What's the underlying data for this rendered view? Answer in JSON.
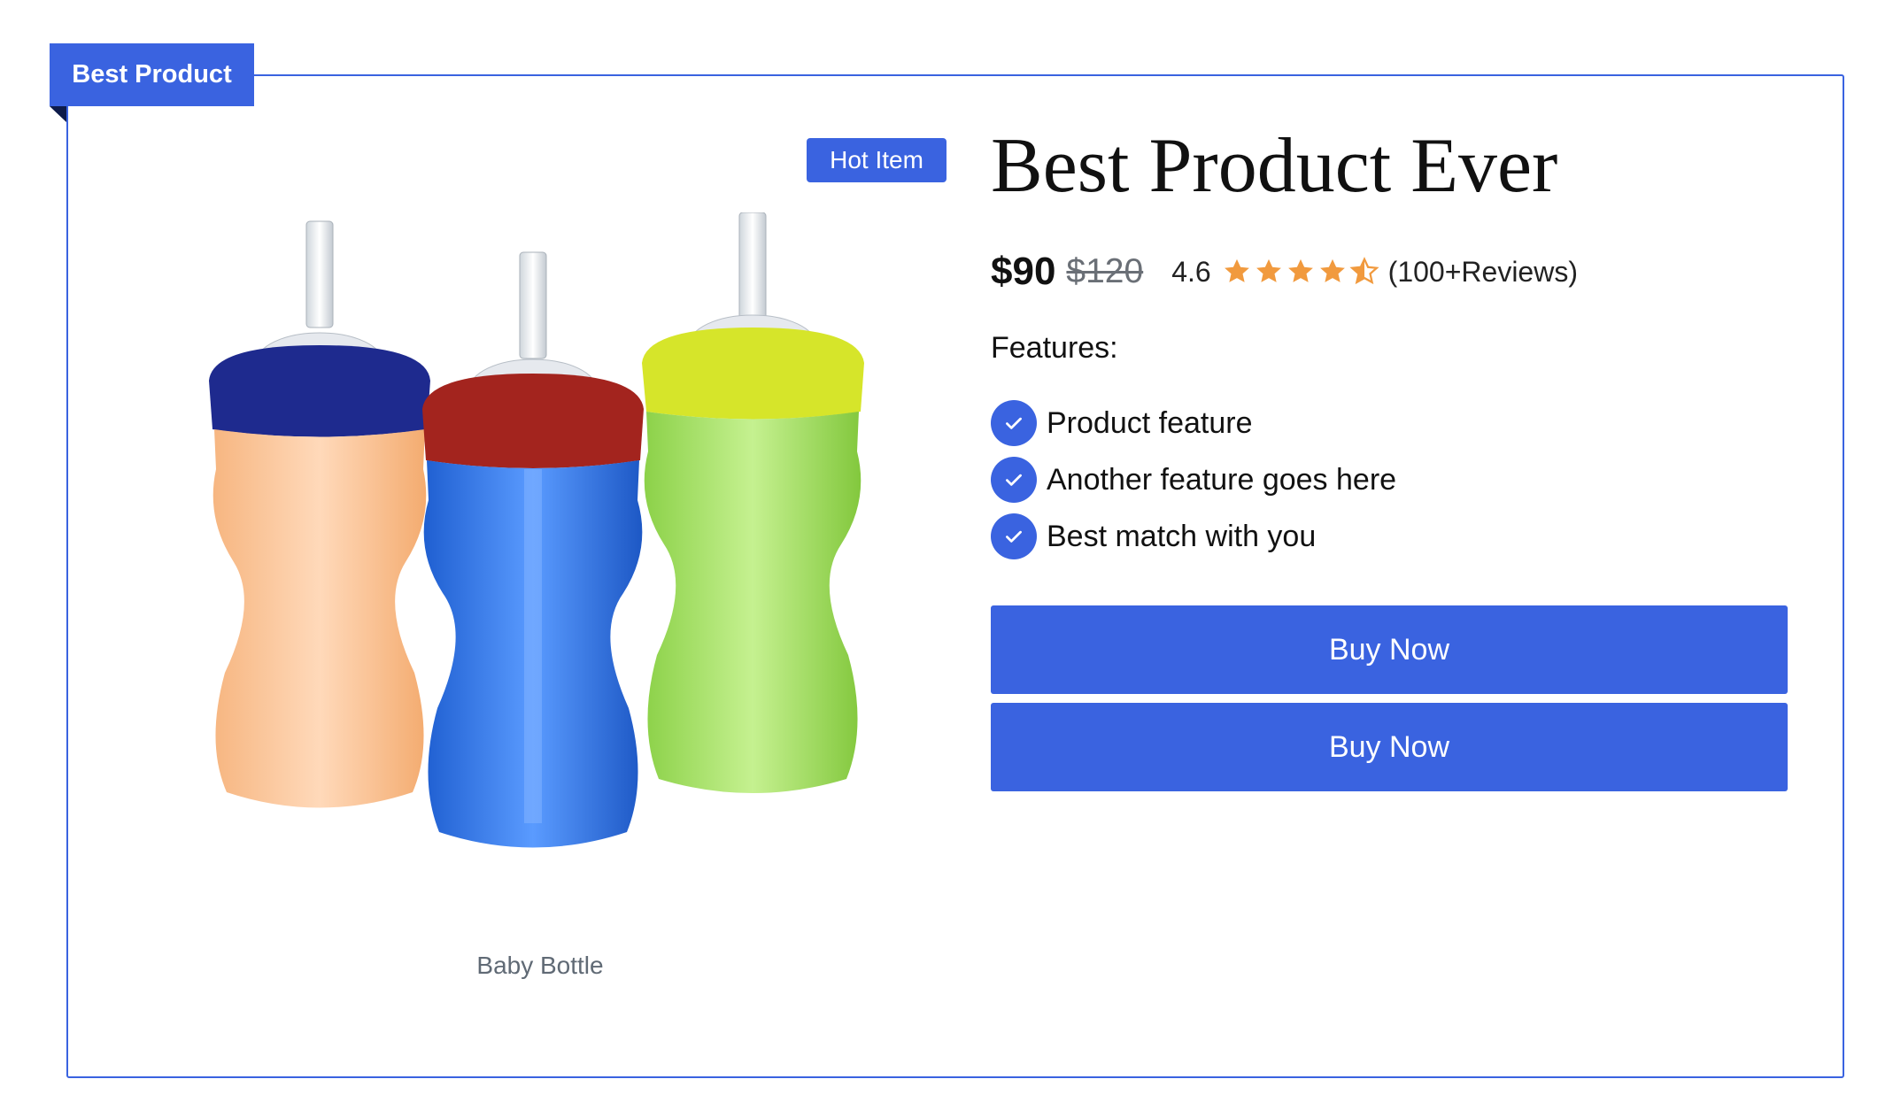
{
  "badge": {
    "label": "Best Product"
  },
  "hot_tag": {
    "label": "Hot Item"
  },
  "image": {
    "caption": "Baby Bottle",
    "alt": "Baby Bottle"
  },
  "product": {
    "title": "Best Product Ever",
    "price": "$90",
    "old_price": "$120",
    "rating": "4.6",
    "rating_value": 4.6,
    "rating_max": 5,
    "reviews": "(100+Reviews)"
  },
  "features": {
    "heading": "Features:",
    "items": [
      {
        "label": "Product feature"
      },
      {
        "label": "Another feature goes here"
      },
      {
        "label": "Best match with you"
      }
    ]
  },
  "actions": {
    "buy_now_1": "Buy Now",
    "buy_now_2": "Buy Now"
  },
  "colors": {
    "accent": "#3a63e0",
    "star": "#f19a3e",
    "text": "#111111",
    "muted": "#606a75"
  }
}
